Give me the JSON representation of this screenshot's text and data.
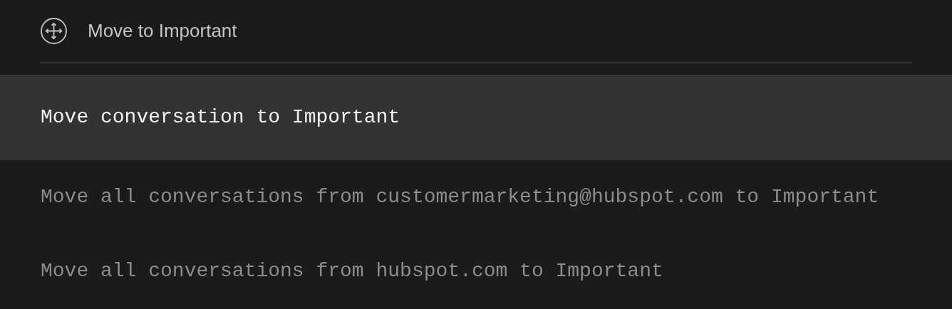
{
  "header": {
    "title": "Move to Important"
  },
  "options": [
    {
      "label": "Move conversation to Important",
      "selected": true
    },
    {
      "label": "Move all conversations from customermarketing@hubspot.com to Important",
      "selected": false
    },
    {
      "label": "Move all conversations from hubspot.com to Important",
      "selected": false
    }
  ]
}
